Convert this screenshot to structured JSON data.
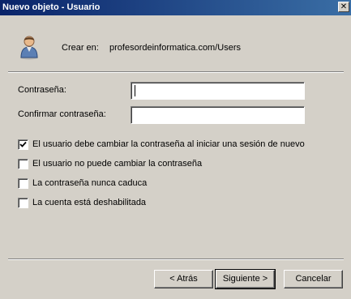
{
  "window": {
    "title": "Nuevo objeto - Usuario",
    "close_glyph": "✕"
  },
  "header": {
    "icon": "user-icon",
    "create_label": "Crear en:",
    "create_path": "profesordeinformatica.com/Users"
  },
  "fields": {
    "password_label": "Contraseña:",
    "password_value": "",
    "confirm_label": "Confirmar contraseña:",
    "confirm_value": ""
  },
  "options": [
    {
      "label": "El usuario debe cambiar la contraseña al iniciar una sesión de nuevo",
      "checked": true
    },
    {
      "label": "El usuario no puede cambiar la contraseña",
      "checked": false
    },
    {
      "label": "La contraseña nunca caduca",
      "checked": false
    },
    {
      "label": "La cuenta está deshabilitada",
      "checked": false
    }
  ],
  "buttons": {
    "back": "< Atrás",
    "next": "Siguiente >",
    "cancel": "Cancelar"
  }
}
